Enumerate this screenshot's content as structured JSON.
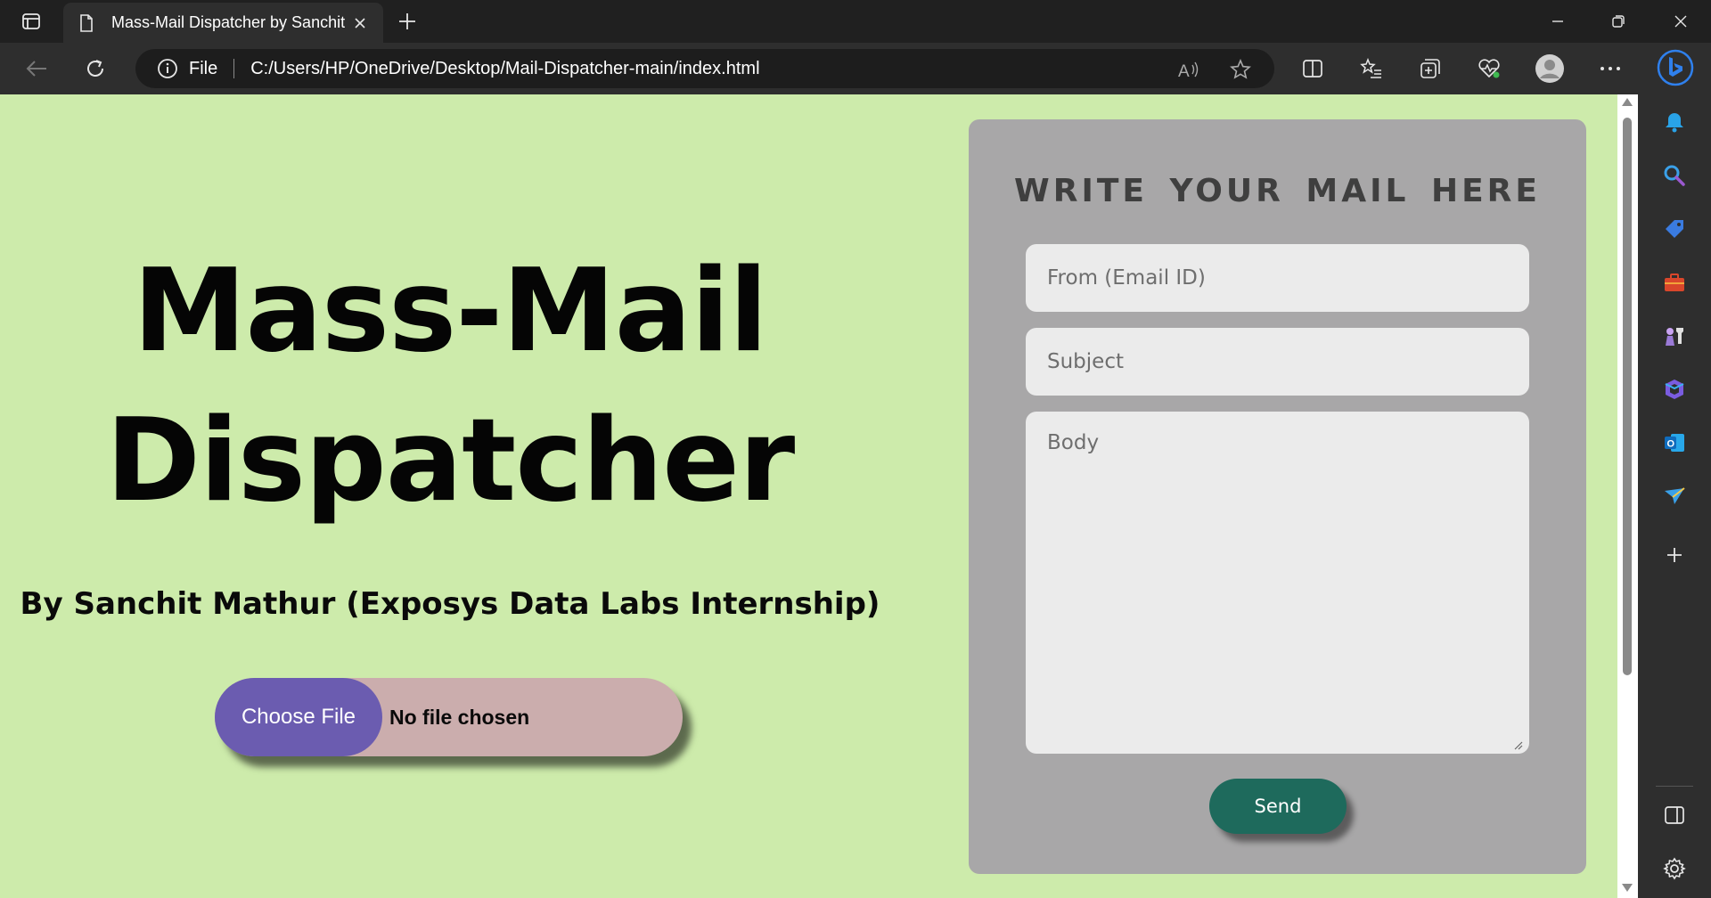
{
  "browser": {
    "tab_title": "Mass-Mail Dispatcher by Sanchit",
    "address_scheme": "File",
    "address_url": "C:/Users/HP/OneDrive/Desktop/Mail-Dispatcher-main/index.html"
  },
  "page": {
    "hero_title_line1": "Mass-Mail",
    "hero_title_line2": "Dispatcher",
    "subtitle": "By Sanchit Mathur (Exposys Data Labs Internship)",
    "file_button": "Choose File",
    "file_status": "No file chosen"
  },
  "form": {
    "heading": "WRITE YOUR  MAIL  HERE",
    "from_placeholder": "From (Email ID)",
    "subject_placeholder": "Subject",
    "body_placeholder": "Body",
    "send_label": "Send"
  },
  "colors": {
    "page_background": "#cdebab",
    "card_background": "#a8a7a8",
    "file_button": "#6b5cb0",
    "send_button": "#1e6a5c"
  }
}
